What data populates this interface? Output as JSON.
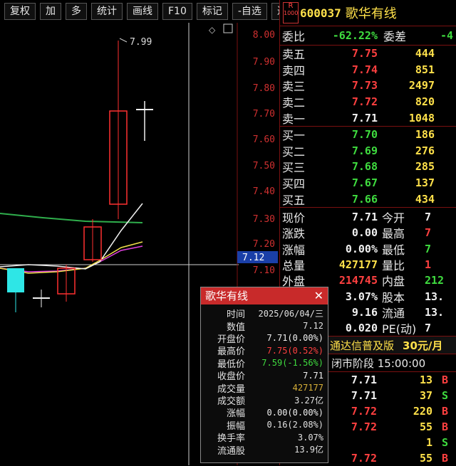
{
  "toolbar": {
    "items": [
      "复权",
      "加",
      "多",
      "统计",
      "画线",
      "F10",
      "标记",
      "-自选",
      "返回"
    ]
  },
  "chart": {
    "price_ticks": [
      "8.00",
      "7.90",
      "7.80",
      "7.70",
      "7.60",
      "7.50",
      "7.40",
      "7.30",
      "7.20",
      "7.10"
    ],
    "high_marker": "7.99",
    "crosshair_value": "7.12"
  },
  "chart_data": {
    "type": "candlestick",
    "y_axis_ticks": [
      8.0,
      7.9,
      7.8,
      7.7,
      7.6,
      7.5,
      7.4,
      7.3,
      7.2,
      7.1
    ],
    "annotations": [
      "7.99"
    ],
    "crosshair_price": 7.12
  },
  "stock": {
    "code": "600037",
    "name": "歌华有线",
    "logo": "R1000"
  },
  "order_book": {
    "weibi": {
      "label": "委比",
      "value": "-62.22%",
      "label2": "委差",
      "value2": "-4"
    },
    "sell": [
      {
        "label": "卖五",
        "price": "7.75",
        "vol": "444"
      },
      {
        "label": "卖四",
        "price": "7.74",
        "vol": "851"
      },
      {
        "label": "卖三",
        "price": "7.73",
        "vol": "2497"
      },
      {
        "label": "卖二",
        "price": "7.72",
        "vol": "820"
      },
      {
        "label": "卖一",
        "price": "7.71",
        "vol": "1048"
      }
    ],
    "buy": [
      {
        "label": "买一",
        "price": "7.70",
        "vol": "186"
      },
      {
        "label": "买二",
        "price": "7.69",
        "vol": "276"
      },
      {
        "label": "买三",
        "price": "7.68",
        "vol": "285"
      },
      {
        "label": "买四",
        "price": "7.67",
        "vol": "137"
      },
      {
        "label": "买五",
        "price": "7.66",
        "vol": "434"
      }
    ]
  },
  "stats": [
    {
      "l1": "现价",
      "v1": "7.71",
      "l2": "今开",
      "v2": "7"
    },
    {
      "l1": "涨跌",
      "v1": "0.00",
      "l2": "最高",
      "v2": "7"
    },
    {
      "l1": "涨幅",
      "v1": "0.00%",
      "l2": "最低",
      "v2": "7"
    },
    {
      "l1": "总量",
      "v1": "427177",
      "l2": "量比",
      "v2": "1"
    },
    {
      "l1": "外盘",
      "v1": "214745",
      "l2": "内盘",
      "v2": "212"
    },
    {
      "l1": "",
      "v1": "3.07%",
      "l2": "股本",
      "v2": "13."
    },
    {
      "l1": "",
      "v1": "9.16",
      "l2": "流通",
      "v2": "13."
    },
    {
      "l1": "",
      "v1": "0.020",
      "l2": "PE(动)",
      "v2": "7"
    }
  ],
  "ad_banner": {
    "text": "通达信普及版",
    "price": "30元/月"
  },
  "session": {
    "text": "闭市阶段 15:00:00"
  },
  "ticks": [
    {
      "time": "",
      "price": "7.71",
      "vol": "13",
      "flag": "B"
    },
    {
      "time": "",
      "price": "7.71",
      "vol": "37",
      "flag": "S"
    },
    {
      "time": "",
      "price": "7.72",
      "vol": "220",
      "flag": "B"
    },
    {
      "time": "",
      "price": "7.72",
      "vol": "55",
      "flag": "B"
    },
    {
      "time": "",
      "price": "",
      "vol": "1",
      "flag": "S"
    },
    {
      "time": "",
      "price": "7.72",
      "vol": "55",
      "flag": "B"
    }
  ],
  "popup": {
    "title": "歌华有线",
    "rows": [
      {
        "label": "时间",
        "value": "2025/06/04/三"
      },
      {
        "label": "数值",
        "value": "7.12"
      },
      {
        "label": "开盘价",
        "value": "7.71(0.00%)"
      },
      {
        "label": "最高价",
        "value": "7.75(0.52%)"
      },
      {
        "label": "最低价",
        "value": "7.59(-1.56%)"
      },
      {
        "label": "收盘价",
        "value": "7.71"
      },
      {
        "label": "成交量",
        "value": "427177"
      },
      {
        "label": "成交额",
        "value": "3.27亿"
      },
      {
        "label": "涨幅",
        "value": "0.00(0.00%)"
      },
      {
        "label": "振幅",
        "value": "0.16(2.08%)"
      },
      {
        "label": "换手率",
        "value": "3.07%"
      },
      {
        "label": "流通股",
        "value": "13.9亿"
      }
    ]
  },
  "colors": {
    "up": "#ff4040",
    "down": "#3fdc3f",
    "accent": "#ffe14a",
    "popup_header": "#c82a2a"
  }
}
